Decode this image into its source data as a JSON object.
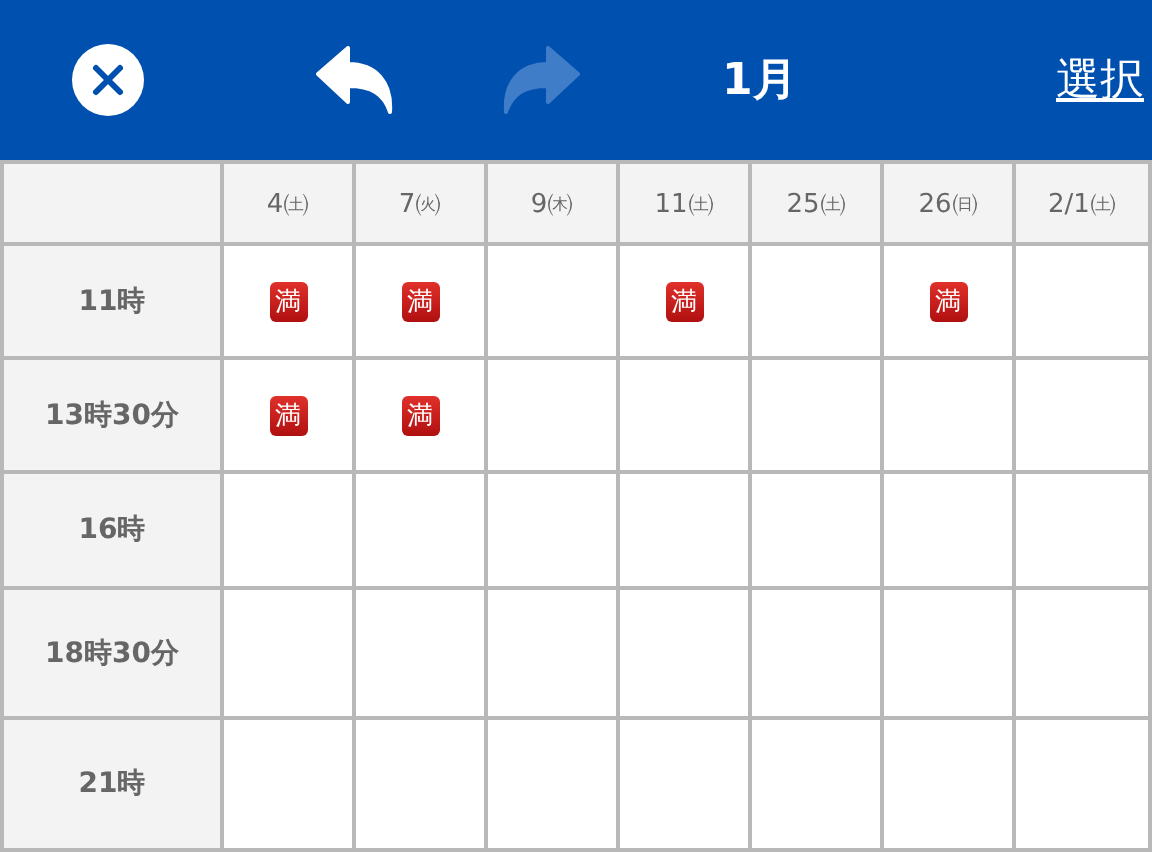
{
  "navbar": {
    "close": {
      "disabled": false
    },
    "undo": {
      "disabled": false
    },
    "redo": {
      "disabled": true
    },
    "title": "1月",
    "action": "選択"
  },
  "table": {
    "columns": [
      "4㈯",
      "7㈫",
      "9㈭",
      "11㈯",
      "25㈯",
      "26㈰",
      "2/1㈯"
    ],
    "rows": [
      {
        "label": "11時",
        "cells": [
          {
            "full": true,
            "badge": "満"
          },
          {
            "full": true,
            "badge": "満"
          },
          {
            "full": false
          },
          {
            "full": true,
            "badge": "満"
          },
          {
            "full": false
          },
          {
            "full": true,
            "badge": "満"
          },
          {
            "full": false
          }
        ]
      },
      {
        "label": "13時30分",
        "cells": [
          {
            "full": true,
            "badge": "満"
          },
          {
            "full": true,
            "badge": "満"
          },
          {
            "full": false
          },
          {
            "full": false
          },
          {
            "full": false
          },
          {
            "full": false
          },
          {
            "full": false
          }
        ]
      },
      {
        "label": "16時",
        "cells": [
          {
            "full": false
          },
          {
            "full": false
          },
          {
            "full": false
          },
          {
            "full": false
          },
          {
            "full": false
          },
          {
            "full": false
          },
          {
            "full": false
          }
        ]
      },
      {
        "label": "18時30分",
        "cells": [
          {
            "full": false
          },
          {
            "full": false
          },
          {
            "full": false
          },
          {
            "full": false
          },
          {
            "full": false
          },
          {
            "full": false
          },
          {
            "full": false
          }
        ]
      },
      {
        "label": "21時",
        "cells": [
          {
            "full": false
          },
          {
            "full": false
          },
          {
            "full": false
          },
          {
            "full": false
          },
          {
            "full": false
          },
          {
            "full": false
          },
          {
            "full": false
          }
        ]
      }
    ]
  }
}
